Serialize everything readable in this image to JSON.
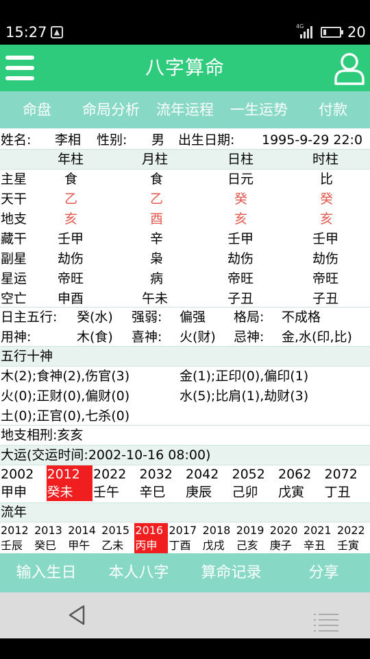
{
  "status_bar": {
    "time": "15:27",
    "network": "4G",
    "battery_level": "20",
    "battery_fraction": 0.2
  },
  "app_bar": {
    "title": "八字算命"
  },
  "tabs": [
    "命盘",
    "命局分析",
    "流年运程",
    "一生运势",
    "付款"
  ],
  "info": {
    "name_label": "姓名:",
    "name": "李相",
    "gender_label": "性别:",
    "gender": "男",
    "birth_label": "出生日期:",
    "birth": "1995-9-29 22:0"
  },
  "pillars": {
    "headers": [
      "年柱",
      "月柱",
      "日柱",
      "时柱"
    ],
    "rows": [
      {
        "label": "主星",
        "values": [
          "食",
          "食",
          "日元",
          "比"
        ]
      },
      {
        "label": "天干",
        "values": [
          "乙",
          "乙",
          "癸",
          "癸"
        ]
      },
      {
        "label": "地支",
        "values": [
          "亥",
          "酉",
          "亥",
          "亥"
        ]
      },
      {
        "label": "藏干",
        "values": [
          "壬甲",
          "辛",
          "壬甲",
          "壬甲"
        ]
      },
      {
        "label": "副星",
        "values": [
          "劫伤",
          "枭",
          "劫伤",
          "劫伤"
        ]
      },
      {
        "label": "星运",
        "values": [
          "帝旺",
          "病",
          "帝旺",
          "帝旺"
        ]
      },
      {
        "label": "空亡",
        "values": [
          "申酉",
          "午未",
          "子丑",
          "子丑"
        ]
      }
    ]
  },
  "analysis": {
    "rizhu_label": "日主五行:",
    "rizhu": "癸(水)",
    "strength_label": "强弱:",
    "strength": "偏强",
    "geju_label": "格局:",
    "geju": "不成格",
    "yongshen_label": "用神:",
    "yongshen": "木(食)",
    "xishen_label": "喜神:",
    "xishen": "火(财)",
    "jishen_label": "忌神:",
    "jishen": "金,水(印,比)"
  },
  "wuxing": {
    "title": "五行十神",
    "items": [
      "木(2);食神(2),伤官(3)",
      "金(1);正印(0),偏印(1)",
      "火(0);正财(0),偏财(0)",
      "水(5);比肩(1),劫财(3)",
      "土(0);正官(0),七杀(0)"
    ]
  },
  "dizhi": {
    "text": "地支相刑:亥亥"
  },
  "dayun": {
    "title": "大运(交运时间:2002-10-16 08:00)",
    "years": [
      "2002",
      "2012",
      "2022",
      "2032",
      "2042",
      "2052",
      "2062",
      "2072"
    ],
    "ganzhi": [
      "甲申",
      "癸未",
      "壬午",
      "辛巳",
      "庚辰",
      "己卯",
      "戊寅",
      "丁丑"
    ],
    "highlight_index": 1
  },
  "liunian": {
    "title": "流年",
    "years": [
      "2012",
      "2013",
      "2014",
      "2015",
      "2016",
      "2017",
      "2018",
      "2019",
      "2020",
      "2021",
      "2022"
    ],
    "ganzhi": [
      "壬辰",
      "癸巳",
      "甲午",
      "乙未",
      "丙申",
      "丁酉",
      "戊戌",
      "己亥",
      "庚子",
      "辛丑",
      "壬寅"
    ],
    "highlight_index": 4
  },
  "bottom_bar": [
    "输入生日",
    "本人八字",
    "算命记录",
    "分享"
  ],
  "colors": {
    "primary": "#2ecb7c",
    "tab_bg": "#87d9c6",
    "red_text": "#e5584f",
    "highlight": "#f01e1e"
  }
}
